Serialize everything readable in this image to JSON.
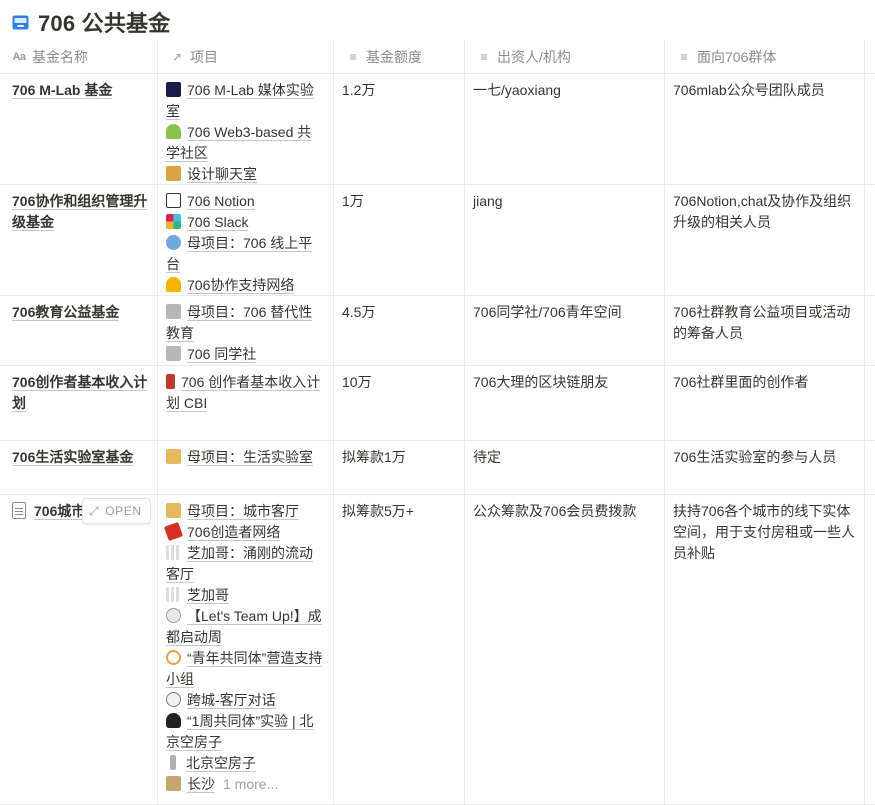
{
  "page": {
    "title": "706 公共基金",
    "icon": "atm-icon"
  },
  "columns": [
    {
      "label": "基金名称",
      "icon": "title-aa-icon"
    },
    {
      "label": "项目",
      "icon": "relation-arrow-icon"
    },
    {
      "label": "基金额度",
      "icon": "text-lines-icon"
    },
    {
      "label": "出资人/机构",
      "icon": "text-lines-icon"
    },
    {
      "label": "面向706群体",
      "icon": "text-lines-icon"
    }
  ],
  "rows": [
    {
      "name": "706 M-Lab 基金",
      "projects": [
        {
          "icon": "mlab-icon",
          "label": "706 M-Lab 媒体实验室"
        },
        {
          "icon": "sprout-icon",
          "label": "706 Web3-based 共学社区"
        },
        {
          "icon": "chat-icon",
          "label": "设计聊天室"
        }
      ],
      "amount": "1.2万",
      "funder": "一七/yaoxiang",
      "target": "706mlab公众号团队成员"
    },
    {
      "name": "706协作和组织管理升级基金",
      "projects": [
        {
          "icon": "notion-icon",
          "label": "706 Notion"
        },
        {
          "icon": "slack-icon",
          "label": "706 Slack"
        },
        {
          "icon": "globe-icon",
          "label": "母项目：706 线上平台"
        },
        {
          "icon": "bell-icon",
          "label": "706协作支持网络"
        }
      ],
      "amount": "1万",
      "funder": "jiang",
      "target": "706Notion,chat及协作及组织升级的相关人员"
    },
    {
      "name": "706教育公益基金",
      "projects": [
        {
          "icon": "building-icon",
          "label": "母项目：706 替代性教育"
        },
        {
          "icon": "building-icon",
          "label": "706 同学社"
        }
      ],
      "amount": "4.5万",
      "funder": "706同学社/706青年空间",
      "target": "706社群教育公益项目或活动的筹备人员"
    },
    {
      "name": "706创作者基本收入计划",
      "projects": [
        {
          "icon": "book-icon",
          "label": "706 创作者基本收入计划 CBI"
        }
      ],
      "amount": "10万",
      "funder": "706大理的区块链朋友",
      "target": "706社群里面的创作者"
    },
    {
      "name": "706生活实验室基金",
      "projects": [
        {
          "icon": "house-icon",
          "label": "母项目：生活实验室"
        }
      ],
      "amount": "拟筹款1万",
      "funder": "待定",
      "target": "706生活实验室的参与人员"
    },
    {
      "name": "706城市",
      "open_label": "OPEN",
      "projects": [
        {
          "icon": "house-icon",
          "label": "母项目：城市客厅"
        },
        {
          "icon": "ticket-icon",
          "label": "706创造者网络"
        },
        {
          "icon": "grid-icon",
          "label": "芝加哥：涌刚的流动客厅"
        },
        {
          "icon": "grid-icon",
          "label": "芝加哥"
        },
        {
          "icon": "bear-icon",
          "label": "【Let's Team Up!】成都启动周"
        },
        {
          "icon": "ring-icon",
          "label": "“青年共同体”营造支持小组"
        },
        {
          "icon": "clock-icon",
          "label": "跨城-客厅对话"
        },
        {
          "icon": "spade-icon",
          "label": "“1周共同体”实验 | 北京空房子"
        },
        {
          "icon": "pin-icon",
          "label": "北京空房子"
        },
        {
          "icon": "flag-icon",
          "label": "长沙"
        }
      ],
      "more": "1 more...",
      "amount": "拟筹款5万+",
      "funder": "公众筹款及706会员费拨款",
      "target": "扶持706各个城市的线下实体空间，用于支付房租或一些人员补贴"
    }
  ],
  "colors": {
    "border": "#e9e9e7",
    "text": "#37352f",
    "muted": "#9b9a97",
    "accent": "#2f80ed"
  }
}
